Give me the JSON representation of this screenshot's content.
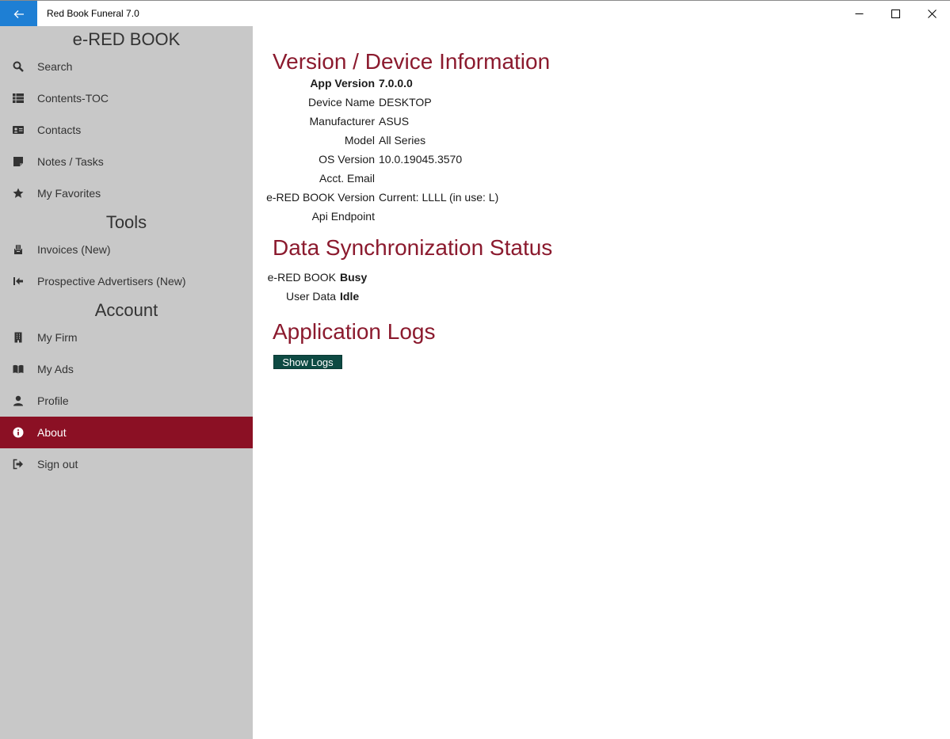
{
  "window": {
    "title": "Red Book Funeral 7.0"
  },
  "sidebar": {
    "headings": {
      "main": "e-RED BOOK",
      "tools": "Tools",
      "account": "Account"
    },
    "items": [
      {
        "label": "Search",
        "icon": "search-icon"
      },
      {
        "label": "Contents-TOC",
        "icon": "table-list-icon"
      },
      {
        "label": "Contacts",
        "icon": "address-card-icon"
      },
      {
        "label": "Notes / Tasks",
        "icon": "sticky-note-icon"
      },
      {
        "label": "My Favorites",
        "icon": "star-icon"
      },
      {
        "label": "Invoices (New)",
        "icon": "invoice-icon"
      },
      {
        "label": "Prospective Advertisers (New)",
        "icon": "arrow-to-left-icon"
      },
      {
        "label": "My Firm",
        "icon": "building-icon"
      },
      {
        "label": "My Ads",
        "icon": "book-open-icon"
      },
      {
        "label": "Profile",
        "icon": "user-icon"
      },
      {
        "label": "About",
        "icon": "info-circle-icon",
        "active": true
      },
      {
        "label": "Sign out",
        "icon": "sign-out-icon"
      }
    ]
  },
  "device_info": {
    "heading": "Version / Device Information",
    "rows": [
      {
        "label": "App Version",
        "value": "7.0.0.0",
        "bold": true
      },
      {
        "label": "Device Name",
        "value": "DESKTOP"
      },
      {
        "label": "Manufacturer",
        "value": "ASUS"
      },
      {
        "label": "Model",
        "value": "All Series"
      },
      {
        "label": "OS Version",
        "value": "10.0.19045.3570"
      },
      {
        "label": "Acct. Email",
        "value": ""
      },
      {
        "label": "e-RED BOOK Version",
        "value": "Current: LLLL (in use: L)"
      },
      {
        "label": "Api Endpoint",
        "value": ""
      }
    ]
  },
  "sync_status": {
    "heading": "Data Synchronization Status",
    "rows": [
      {
        "label": "e-RED BOOK",
        "value": "Busy"
      },
      {
        "label": "User Data",
        "value": "Idle"
      }
    ]
  },
  "logs": {
    "heading": "Application Logs",
    "button_label": "Show Logs"
  },
  "colors": {
    "accent_red": "#8b1024",
    "heading_red": "#8b1a2e",
    "sidebar_bg": "#c8c8c8",
    "back_button_blue": "#1e7fd4",
    "button_green": "#0e4a43"
  }
}
